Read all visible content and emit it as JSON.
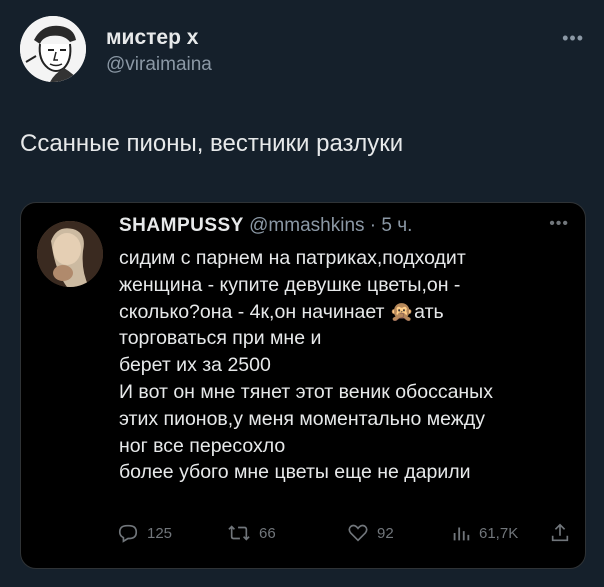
{
  "tweet": {
    "author_name": "мистер х",
    "author_handle": "@viraimaina",
    "more_icon": "more-icon",
    "text": "Ссанные пионы, вестники разлуки"
  },
  "quoted": {
    "author_name": "SHAMPUSSY",
    "author_handle": "@mmashkins",
    "time": "· 5 ч.",
    "text": "сидим с парнем на патриках,подходит\nженщина - купите девушке цветы,он -\nсколько?она - 4к,он начинает 🙊ать\nторговаться при мне и\nберет их за 2500\nИ вот он мне тянет этот веник обоссаных\nэтих пионов,у меня моментально между\nног все пересохло\nболее убого мне цветы еще не дарили",
    "actions": {
      "replies": "125",
      "retweets": "66",
      "likes": "92",
      "views": "61,7K"
    }
  },
  "colors": {
    "background": "#15202b",
    "quote_bg": "#000000",
    "muted": "#8b98a5"
  }
}
